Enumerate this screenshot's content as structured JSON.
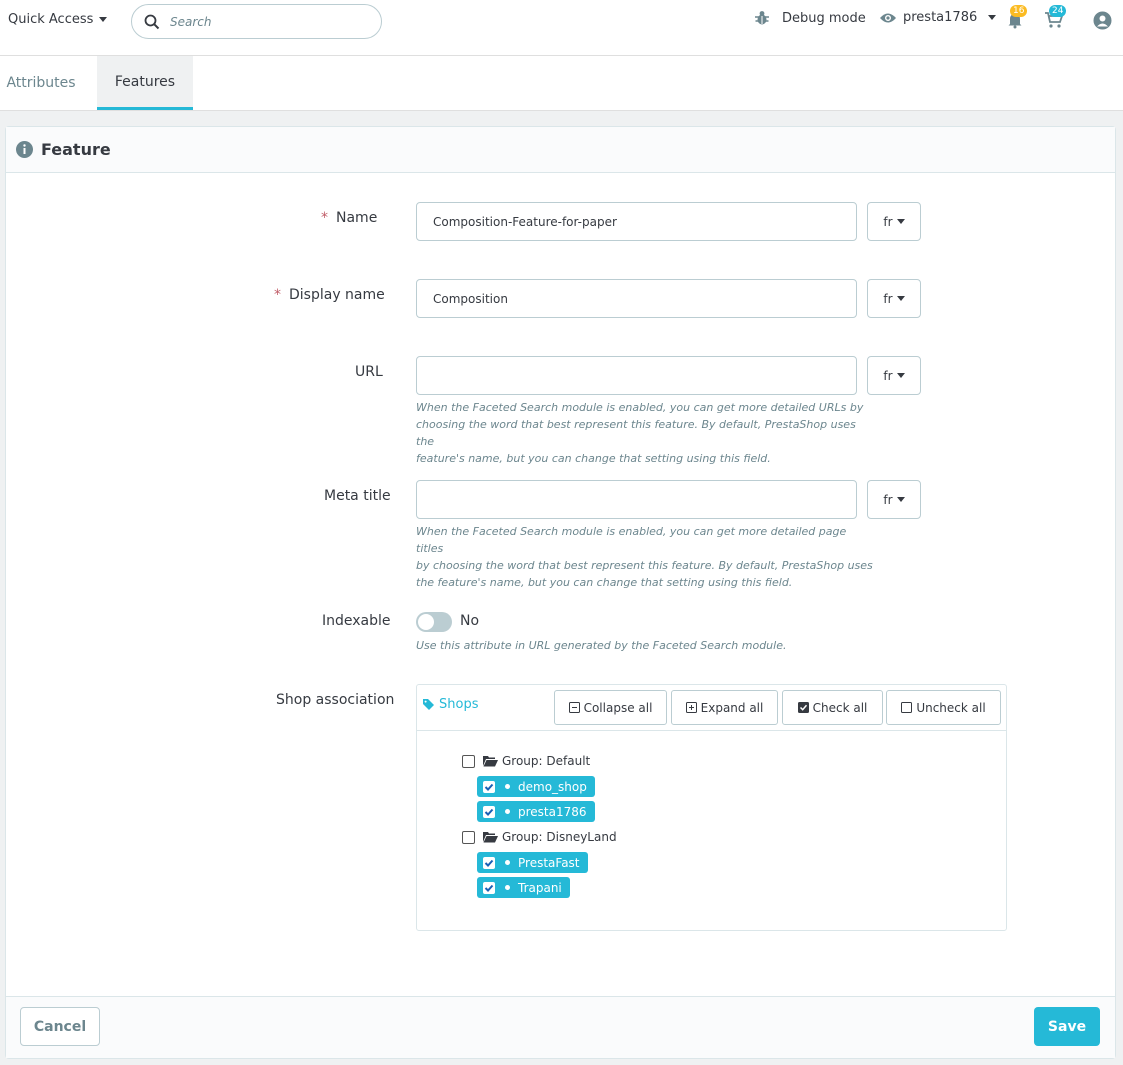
{
  "header": {
    "quick_access": "Quick Access",
    "search_placeholder": "Search",
    "debug_mode": "Debug mode",
    "shop_name": "presta1786",
    "notifications_count": "16",
    "orders_count": "24",
    "colors": {
      "accent": "#25b9d7",
      "notif_badge": "#fbbb22"
    }
  },
  "tabs": [
    {
      "label": "Attributes",
      "active": false
    },
    {
      "label": "Features",
      "active": true
    }
  ],
  "card": {
    "title": "Feature",
    "fields": {
      "name": {
        "label": "Name",
        "required": true,
        "value": "Composition-Feature-for-paper",
        "lang": "fr"
      },
      "display_name": {
        "label": "Display name",
        "required": true,
        "value": "Composition",
        "lang": "fr"
      },
      "url": {
        "label": "URL",
        "value": "",
        "lang": "fr",
        "help": [
          "When the Faceted Search module is enabled, you can get more detailed URLs by",
          "choosing the word that best represent this feature. By default, PrestaShop uses the",
          "feature's name, but you can change that setting using this field."
        ]
      },
      "meta_title": {
        "label": "Meta title",
        "value": "",
        "lang": "fr",
        "help": [
          "When the Faceted Search module is enabled, you can get more detailed page titles",
          "by choosing the word that best represent this feature. By default, PrestaShop uses",
          "the feature's name, but you can change that setting using this field."
        ]
      },
      "indexable": {
        "label": "Indexable",
        "state": "No",
        "enabled": false,
        "help": "Use this attribute in URL generated by the Faceted Search module."
      }
    },
    "shop_association": {
      "label": "Shop association",
      "tag": "Shops",
      "buttons": {
        "collapse": "Collapse all",
        "expand": "Expand all",
        "check": "Check all",
        "uncheck": "Uncheck all"
      },
      "groups": [
        {
          "label": "Group: Default",
          "checked": false,
          "shops": [
            {
              "name": "demo_shop",
              "checked": true
            },
            {
              "name": "presta1786",
              "checked": true
            }
          ]
        },
        {
          "label": "Group: DisneyLand",
          "checked": false,
          "shops": [
            {
              "name": "PrestaFast",
              "checked": true
            },
            {
              "name": "Trapani",
              "checked": true
            }
          ]
        }
      ]
    },
    "footer": {
      "cancel": "Cancel",
      "save": "Save"
    }
  }
}
